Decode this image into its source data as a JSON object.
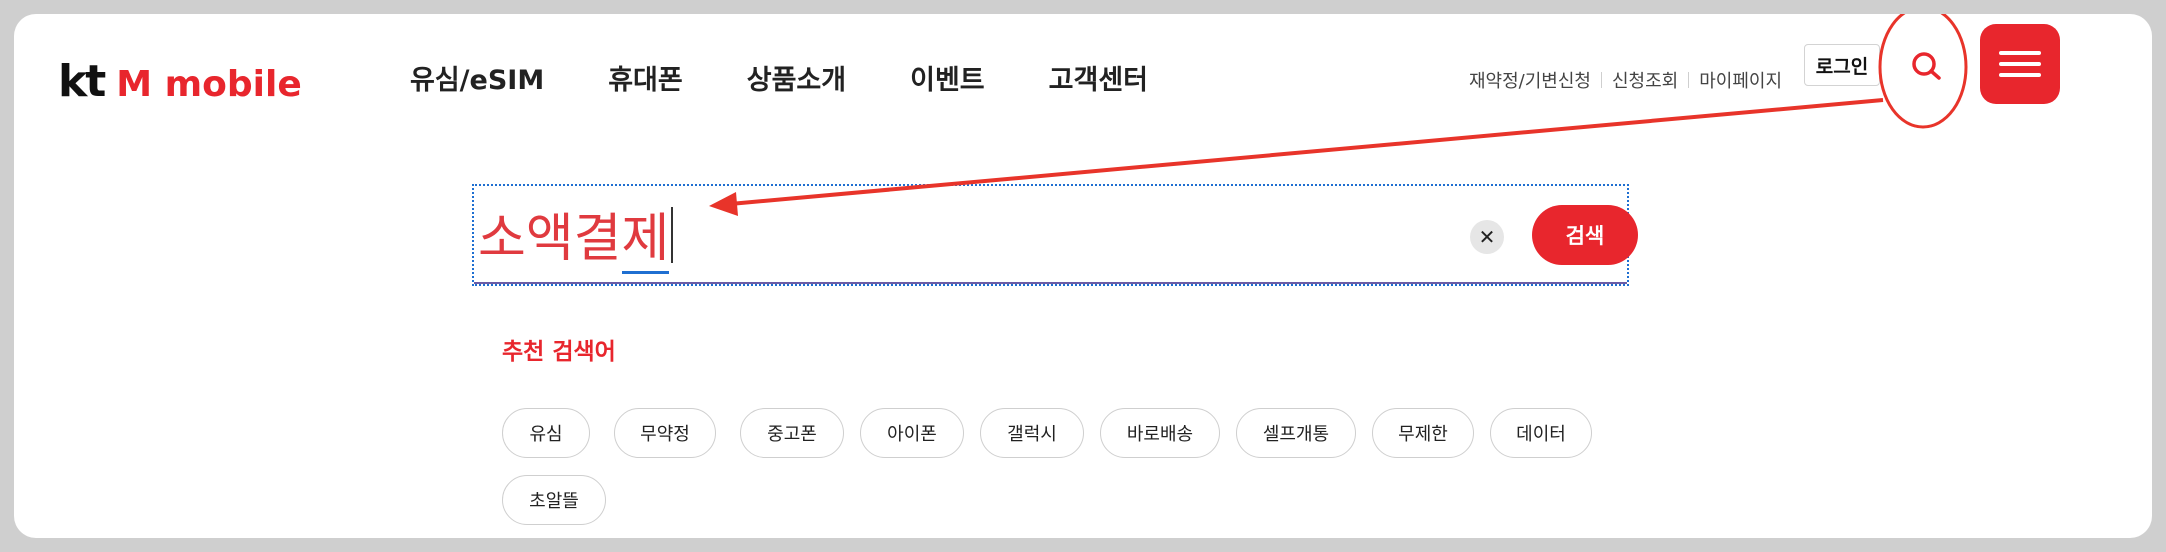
{
  "header": {
    "logo": {
      "kt": "kt",
      "brand": "M mobile"
    },
    "nav": [
      "유심/eSIM",
      "휴대폰",
      "상품소개",
      "이벤트",
      "고객센터"
    ],
    "util_links": [
      "재약정/기변신청",
      "신청조회",
      "마이페이지"
    ],
    "login_label": "로그인",
    "search_icon": "search-icon",
    "menu_icon": "hamburger-menu-icon"
  },
  "search": {
    "typed_committed": "소액결",
    "typed_composing": "제",
    "clear_label": "✕",
    "submit_label": "검색"
  },
  "recommended": {
    "title": "추천 검색어",
    "chips": [
      "유심",
      "무약정",
      "중고폰",
      "아이폰",
      "갤럭시",
      "바로배송",
      "셀프개통",
      "무제한",
      "데이터",
      "초알뜰"
    ]
  },
  "colors": {
    "brand_red": "#e8262d",
    "annotation_red": "#e8342a",
    "focus_blue": "#1f6fd1"
  }
}
